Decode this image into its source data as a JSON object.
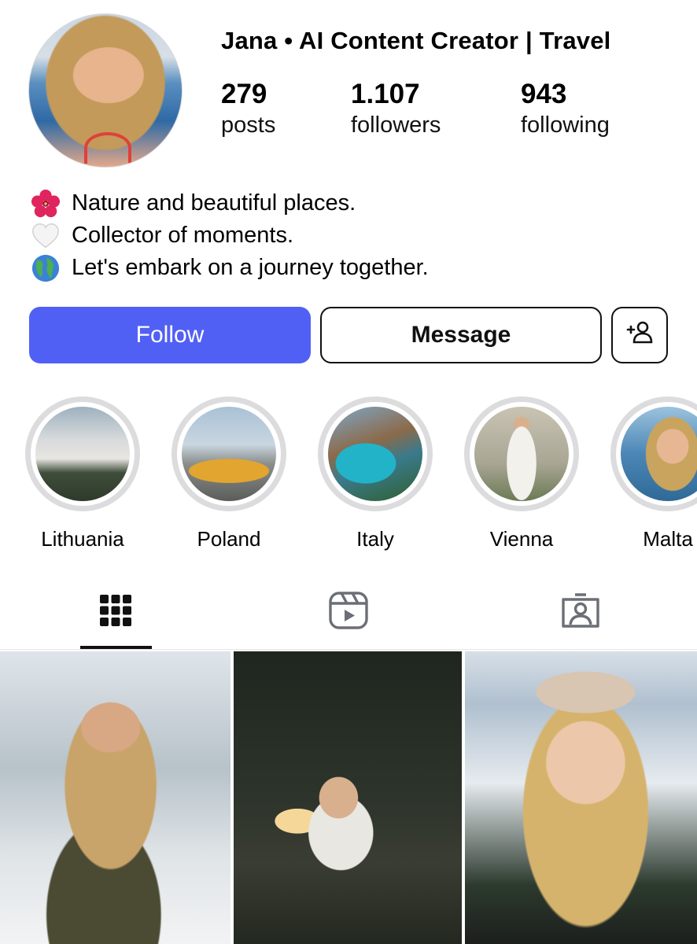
{
  "profile": {
    "name": "Jana • AI Content Creator | Travel",
    "stats": [
      {
        "value": "279",
        "label": "posts"
      },
      {
        "value": "1.107",
        "label": "followers"
      },
      {
        "value": "943",
        "label": "following"
      }
    ],
    "bio": [
      {
        "icon": "hibiscus-icon",
        "text": "Nature and beautiful places."
      },
      {
        "icon": "white-heart-icon",
        "text": "Collector of moments."
      },
      {
        "icon": "globe-icon",
        "text": "Let's embark on a journey together."
      }
    ]
  },
  "actions": {
    "follow": "Follow",
    "message": "Message",
    "add_user_icon": "add-user-icon"
  },
  "highlights": [
    {
      "label": "Lithuania"
    },
    {
      "label": "Poland"
    },
    {
      "label": "Italy"
    },
    {
      "label": "Vienna"
    },
    {
      "label": "Malta"
    }
  ],
  "tabs": [
    {
      "icon": "grid-icon",
      "active": true
    },
    {
      "icon": "reels-icon",
      "active": false
    },
    {
      "icon": "tagged-icon",
      "active": false
    }
  ],
  "colors": {
    "follow_button": "#5160f4",
    "highlight_ring": "#dcdcdf",
    "text": "#000000"
  }
}
